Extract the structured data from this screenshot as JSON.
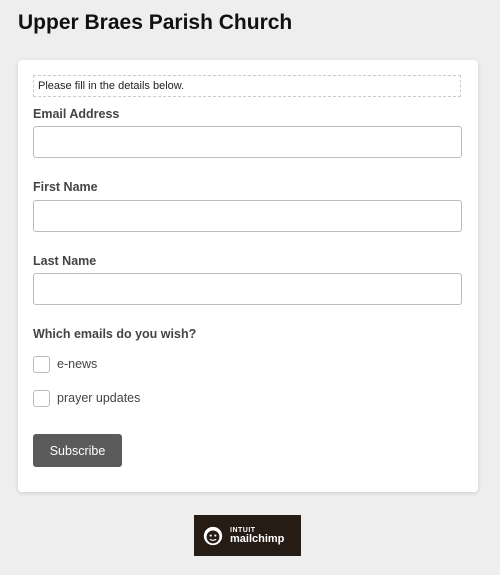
{
  "page": {
    "title": "Upper Braes Parish Church"
  },
  "form": {
    "notice": "Please fill in the details below.",
    "email_label": "Email Address",
    "email_value": "",
    "first_name_label": "First Name",
    "first_name_value": "",
    "last_name_label": "Last Name",
    "last_name_value": "",
    "emails_question": "Which emails do you wish?",
    "options": [
      {
        "label": "e-news",
        "checked": false
      },
      {
        "label": "prayer updates",
        "checked": false
      }
    ],
    "subscribe_label": "Subscribe"
  },
  "badge": {
    "brand": "INTUIT",
    "product": "mailchimp",
    "icon": "mailchimp-freddie-icon"
  },
  "colors": {
    "background": "#eeeeee",
    "card": "#ffffff",
    "button": "#5b5b5b",
    "badge": "#241c15"
  }
}
